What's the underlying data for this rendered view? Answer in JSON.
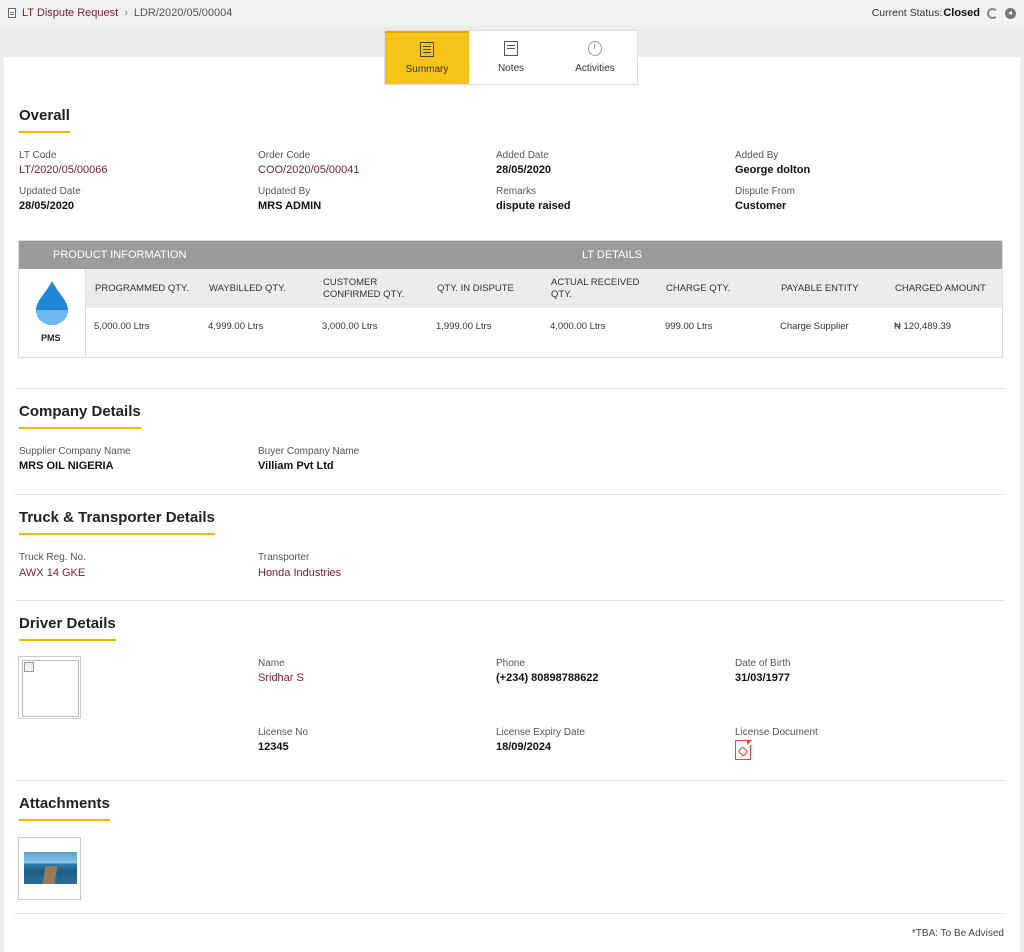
{
  "breadcrumb": {
    "parent": "LT Dispute Request",
    "current": "LDR/2020/05/00004"
  },
  "status": {
    "label": "Current Status:",
    "value": "Closed"
  },
  "tabs": [
    {
      "label": "Summary",
      "icon": "summary-icon",
      "active": true
    },
    {
      "label": "Notes",
      "icon": "notes-icon",
      "active": false
    },
    {
      "label": "Activities",
      "icon": "activities-icon",
      "active": false
    }
  ],
  "overall": {
    "title": "Overall",
    "fields": {
      "lt_code": {
        "label": "LT Code",
        "value": "LT/2020/05/00066"
      },
      "order_code": {
        "label": "Order Code",
        "value": "COO/2020/05/00041"
      },
      "added_date": {
        "label": "Added Date",
        "value": "28/05/2020"
      },
      "added_by": {
        "label": "Added By",
        "value": "George dolton"
      },
      "updated_date": {
        "label": "Updated Date",
        "value": "28/05/2020"
      },
      "updated_by": {
        "label": "Updated By",
        "value": "MRS ADMIN"
      },
      "remarks": {
        "label": "Remarks",
        "value": "dispute raised"
      },
      "dispute_from": {
        "label": "Dispute From",
        "value": "Customer"
      }
    }
  },
  "product_table": {
    "product_header": "PRODUCT INFORMATION",
    "lt_header": "LT DETAILS",
    "product_name": "PMS",
    "columns": [
      "PROGRAMMED QTY.",
      "WAYBILLED QTY.",
      "CUSTOMER CONFIRMED QTY.",
      "QTY. IN DISPUTE",
      "ACTUAL RECEIVED QTY.",
      "CHARGE QTY.",
      "PAYABLE ENTITY",
      "CHARGED AMOUNT"
    ],
    "row": [
      "5,000.00 Ltrs",
      "4,999.00 Ltrs",
      "3,000.00 Ltrs",
      "1,999.00 Ltrs",
      "4,000.00 Ltrs",
      "999.00 Ltrs",
      "Charge Supplier",
      "₦ 120,489.39"
    ]
  },
  "company": {
    "title": "Company Details",
    "supplier": {
      "label": "Supplier Company Name",
      "value": "MRS OIL NIGERIA"
    },
    "buyer": {
      "label": "Buyer Company Name",
      "value": "Villiam Pvt Ltd"
    }
  },
  "truck": {
    "title": "Truck & Transporter Details",
    "reg": {
      "label": "Truck Reg. No.",
      "value": "AWX 14 GKE"
    },
    "transporter": {
      "label": "Transporter",
      "value": "Honda Industries"
    }
  },
  "driver": {
    "title": "Driver Details",
    "name": {
      "label": "Name",
      "value": "Sridhar S"
    },
    "phone": {
      "label": "Phone",
      "value": "(+234) 80898788622"
    },
    "dob": {
      "label": "Date of Birth",
      "value": "31/03/1977"
    },
    "license_no": {
      "label": "License No",
      "value": "12345"
    },
    "license_expiry": {
      "label": "License Expiry Date",
      "value": "18/09/2024"
    },
    "license_doc": {
      "label": "License Document",
      "icon": "pdf-icon"
    }
  },
  "attachments": {
    "title": "Attachments"
  },
  "footnote": "*TBA: To Be Advised",
  "colors": {
    "accent": "#f7c319",
    "link": "#7a1f2b",
    "table_header": "#9b9b9b",
    "pdf": "#e0462c"
  }
}
